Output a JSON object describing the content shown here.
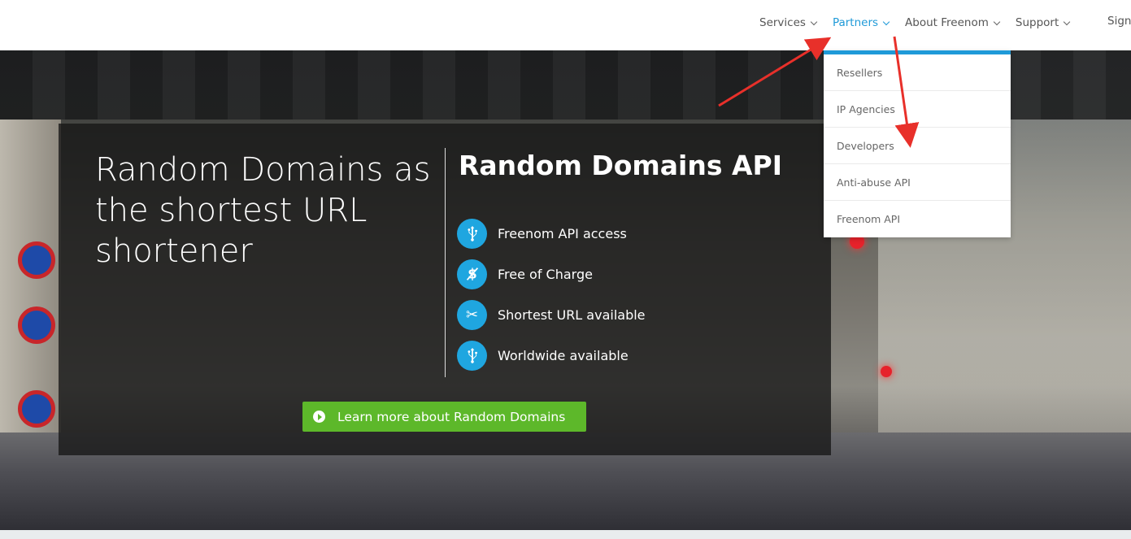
{
  "nav": {
    "items": [
      {
        "label": "Services",
        "active": false
      },
      {
        "label": "Partners",
        "active": true
      },
      {
        "label": "About Freenom",
        "active": false
      },
      {
        "label": "Support",
        "active": false
      }
    ],
    "sign_label": "Sign"
  },
  "dropdown": {
    "items": [
      "Resellers",
      "IP Agencies",
      "Developers",
      "Anti-abuse API",
      "Freenom API"
    ]
  },
  "hero": {
    "headline": "Random Domains as the shortest URL shortener",
    "api_title": "Random Domains API",
    "features": [
      {
        "icon": "usb-icon",
        "label": "Freenom API access"
      },
      {
        "icon": "dollar-slash-icon",
        "label": "Free of Charge"
      },
      {
        "icon": "scissors-icon",
        "label": "Shortest URL available"
      },
      {
        "icon": "usb-icon",
        "label": "Worldwide available"
      }
    ],
    "cta_label": "Learn more about Random Domains"
  },
  "colors": {
    "accent": "#1f9ad8",
    "cta": "#5db82a",
    "icon_bg": "#1fa6e0",
    "annotation": "#e8302a"
  }
}
